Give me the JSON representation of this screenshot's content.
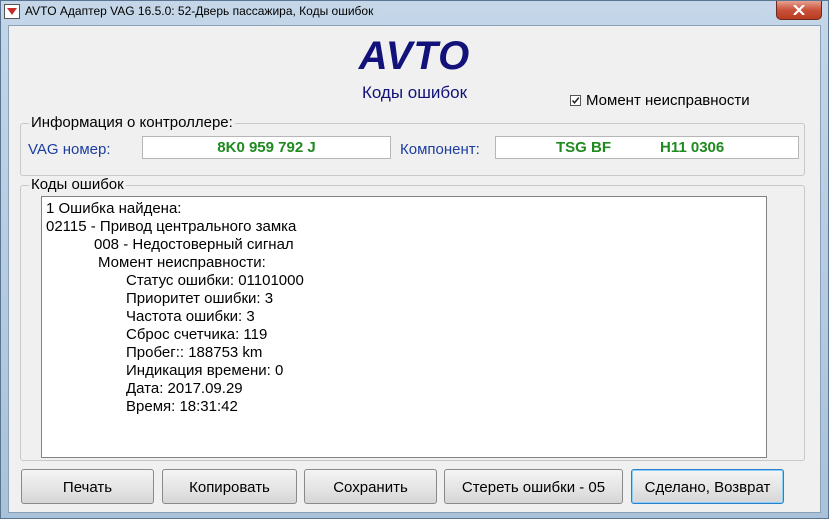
{
  "window": {
    "title": "AVTO Адаптер VAG 16.5.0: 52-Дверь пассажира,  Коды ошибок"
  },
  "header": {
    "brand": "AVTO",
    "subtitle": "Коды ошибок"
  },
  "moment_checkbox": {
    "label": "Момент неисправности",
    "checked": true
  },
  "controller_info": {
    "group_label": "Информация о контроллере:",
    "vag_label": "VAG номер:",
    "vag_value": "8K0 959 792 J",
    "component_label": "Компонент:",
    "component_name": "TSG BF",
    "component_version": "H11 0306",
    "value_color": "#1f8a1f"
  },
  "errors": {
    "group_label": "Коды ошибок",
    "lines": [
      "1 Ошибка найдена:",
      "02115 - Привод центрального замка",
      "008 - Недостоверный сигнал",
      "Момент неисправности:",
      "Статус ошибки: 01101000",
      "Приоритет ошибки: 3",
      "Частота ошибки: 3",
      "Сброс счетчика: 119",
      "Пробег:: 188753 km",
      "Индикация времени: 0",
      "Дата: 2017.09.29",
      "Время: 18:31:42"
    ]
  },
  "buttons": {
    "print": "Печать",
    "copy": "Копировать",
    "save": "Сохранить",
    "clear": "Стереть ошибки - 05",
    "done": "Сделано, Возврат"
  }
}
